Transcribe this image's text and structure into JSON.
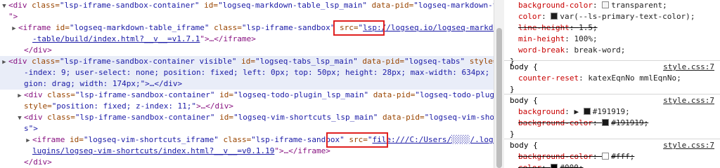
{
  "elements": {
    "line1": {
      "open": "<div ",
      "a1": "class=",
      "v1": "\"lsp-iframe-sandbox-container\"",
      "a2": " id=",
      "v2": "\"logseq-markdown-table_lsp_main\"",
      "a3": " data-pid=",
      "v3": "\"logseq-markdown-table\""
    },
    "line2": {
      "end": "\">"
    },
    "line3": {
      "open": "<iframe ",
      "a1": "id=",
      "v1": "\"logseq-markdown-table_iframe\"",
      "a2": " class=",
      "v2": "\"lsp-iframe-sandbox\"",
      "a3": " src=",
      "v3": "\"",
      "link": "lsp://logseq.io/logseq-markdown"
    },
    "line4": {
      "link": "-table/build/index.html?__v__=v1.7.1",
      "end": "\">…</iframe>"
    },
    "line5": {
      "close": "</div>"
    },
    "line6": {
      "open": "<div ",
      "a1": "class=",
      "v1": "\"lsp-iframe-sandbox-container visible\"",
      "a2": " id=",
      "v2": "\"logseq-tabs_lsp_main\"",
      "a3": " data-pid=",
      "v3": "\"logseq-tabs\"",
      "a4": " style=",
      "v4": "\"z"
    },
    "line7": {
      "text": "-index: 9; user-select: none; position: fixed; left: 0px; top: 50px; height: 28px; max-width: 634px; app-re"
    },
    "line8": {
      "text": "gion: drag; width: 174px;\">…</div>"
    },
    "line9": {
      "open": "<div ",
      "a1": "class=",
      "v1": "\"lsp-iframe-sandbox-container\"",
      "a2": " id=",
      "v2": "\"logseq-todo-plugin_lsp_main\"",
      "a3": " data-pid=",
      "v3": "\"logseq-todo-plugin\""
    },
    "line10": {
      "a1": "style=",
      "v1": "\"position: fixed; z-index: 11;\"",
      "end": ">…</div>"
    },
    "line11": {
      "open": "<div ",
      "a1": "class=",
      "v1": "\"lsp-iframe-sandbox-container\"",
      "a2": " id=",
      "v2": "\"logseq-vim-shortcuts_lsp_main\"",
      "a3": " data-pid=",
      "v3": "\"logseq-vim-shortcut"
    },
    "line12": {
      "text": "s\">"
    },
    "line13": {
      "open": "<iframe ",
      "a1": "id=",
      "v1": "\"logseq-vim-shortcuts_iframe\"",
      "a2": " class=",
      "v2": "\"lsp-iframe-sandbox\"",
      "a3": " src=",
      "v3": "\"",
      "link": "file:///C:/Users/░░░░/.logseq/p"
    },
    "line14": {
      "link": "lugins/logseq-vim-shortcuts/index.html?__v__=v0.1.19",
      "end": "\">…</iframe>"
    },
    "line15": {
      "close": "</div>"
    }
  },
  "styles": {
    "rule1": [
      {
        "prop": "background-color",
        "val": "transparent",
        "swatch": "#f5f5f5",
        "strike": false
      },
      {
        "prop": "color",
        "val": "var(--ls-primary-text-color)",
        "swatch": "#1f1f1f",
        "strike": false
      },
      {
        "prop": "line-height",
        "val": "1.5",
        "strike": true
      },
      {
        "prop": "min-height",
        "val": "100%",
        "strike": false
      },
      {
        "prop": "word-break",
        "val": "break-word",
        "strike": false
      }
    ],
    "rule1_close": "}",
    "rule2": {
      "selector": "body {",
      "source": "style.css:7",
      "prop": "counter-reset",
      "val": "katexEqnNo mmlEqnNo",
      "close": "}"
    },
    "rule3": {
      "selector": "body {",
      "source": "style.css:7",
      "p1": "background",
      "v1": "#191919",
      "p2": "background-color",
      "v2": "#191919",
      "close": "}"
    },
    "rule4": {
      "selector": "body {",
      "source": "style.css:7",
      "p1": "background-color",
      "v1": "#fff",
      "p2": "color",
      "v2": "#000"
    }
  },
  "colors": {
    "highlight": "#e9edf8",
    "tag": "#881280",
    "attr_name": "#994500",
    "attr_value": "#1a1aa6",
    "red_box": "#e02020",
    "prop_name": "#c80000"
  }
}
